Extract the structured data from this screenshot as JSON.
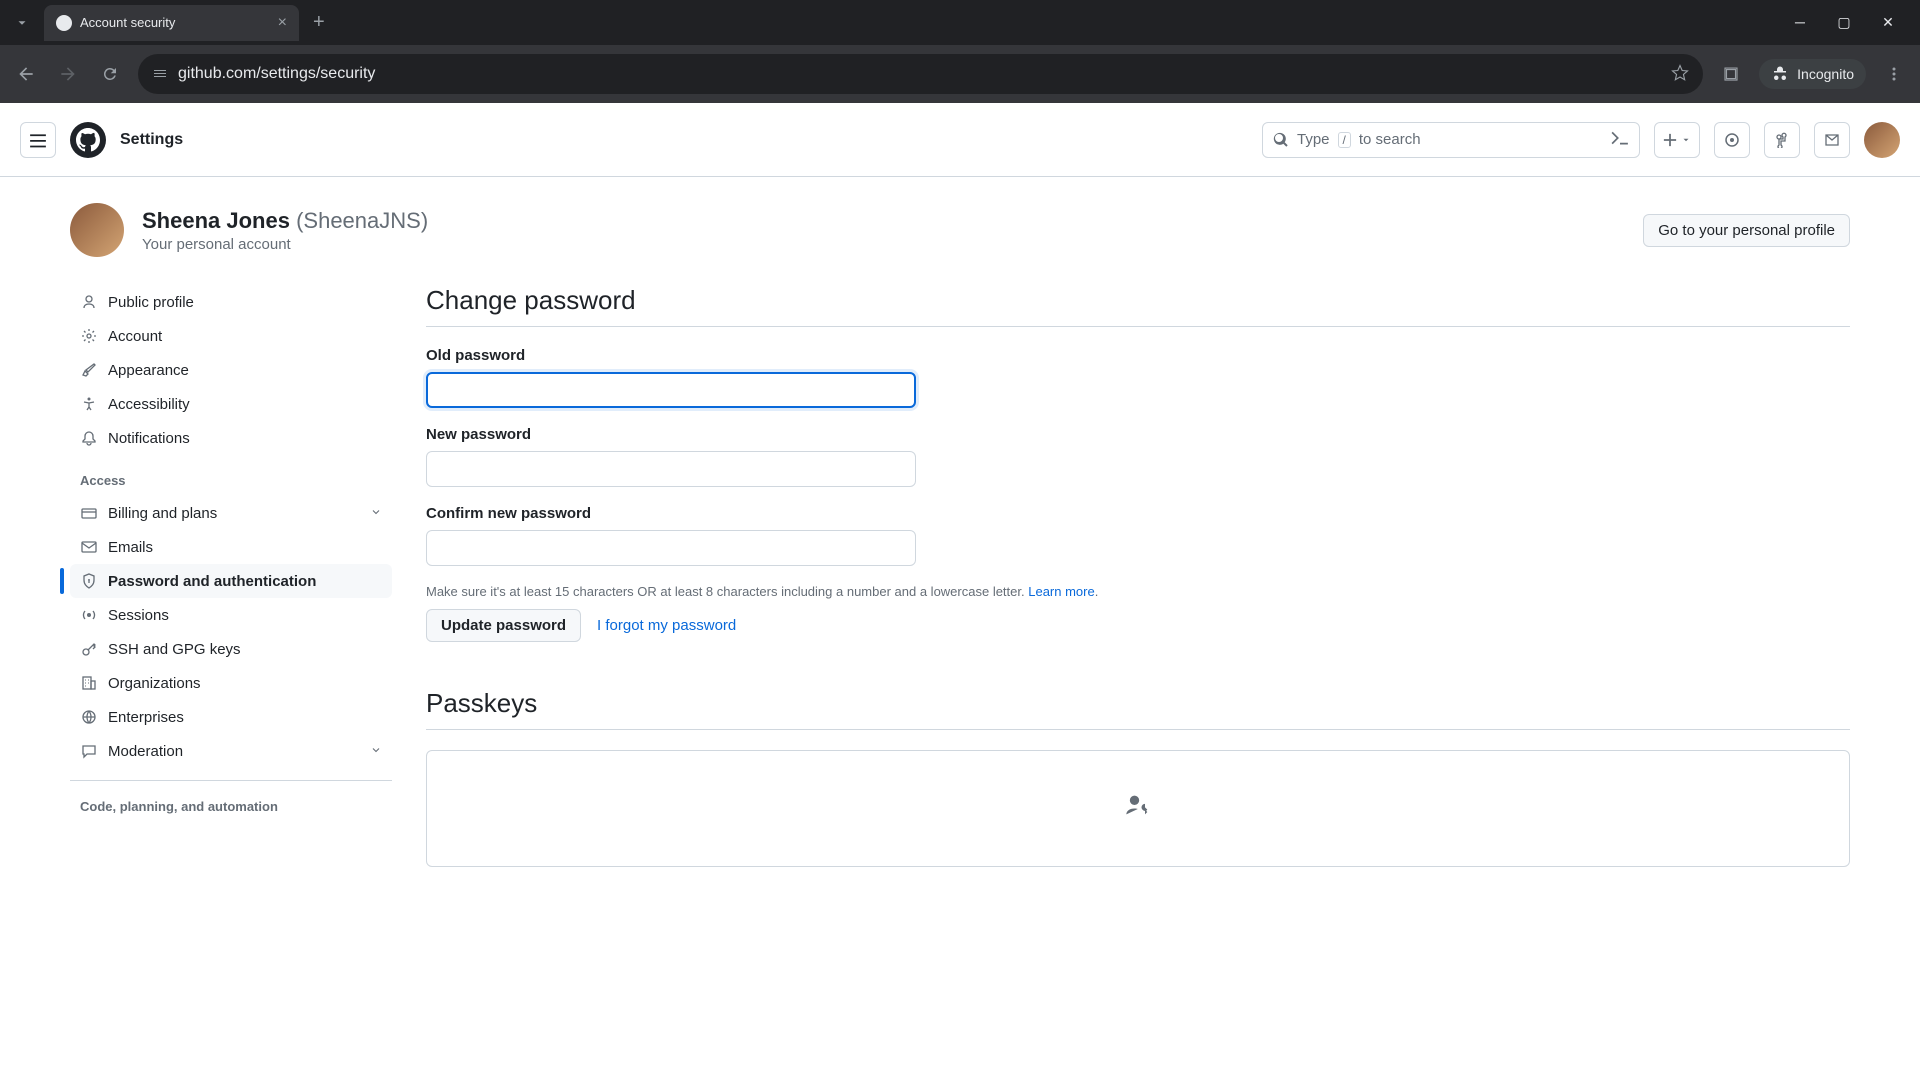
{
  "browser": {
    "tab_title": "Account security",
    "url": "github.com/settings/security",
    "incognito_label": "Incognito"
  },
  "header": {
    "page_title": "Settings",
    "search_prefix": "Type",
    "search_key": "/",
    "search_suffix": "to search"
  },
  "profile": {
    "full_name": "Sheena Jones",
    "username": "(SheenaJNS)",
    "subtitle": "Your personal account",
    "button_label": "Go to your personal profile"
  },
  "sidebar": {
    "items": [
      {
        "label": "Public profile",
        "icon": "person"
      },
      {
        "label": "Account",
        "icon": "gear"
      },
      {
        "label": "Appearance",
        "icon": "brush"
      },
      {
        "label": "Accessibility",
        "icon": "accessibility"
      },
      {
        "label": "Notifications",
        "icon": "bell"
      }
    ],
    "group_access": "Access",
    "access_items": [
      {
        "label": "Billing and plans",
        "icon": "card",
        "expandable": true
      },
      {
        "label": "Emails",
        "icon": "mail"
      },
      {
        "label": "Password and authentication",
        "icon": "shield",
        "active": true
      },
      {
        "label": "Sessions",
        "icon": "broadcast"
      },
      {
        "label": "SSH and GPG keys",
        "icon": "key"
      },
      {
        "label": "Organizations",
        "icon": "org"
      },
      {
        "label": "Enterprises",
        "icon": "globe"
      },
      {
        "label": "Moderation",
        "icon": "comment",
        "expandable": true
      }
    ],
    "group_code": "Code, planning, and automation"
  },
  "main": {
    "change_password_title": "Change password",
    "old_password_label": "Old password",
    "new_password_label": "New password",
    "confirm_password_label": "Confirm new password",
    "hint_text": "Make sure it's at least 15 characters OR at least 8 characters including a number and a lowercase letter.",
    "hint_link": "Learn more",
    "update_button": "Update password",
    "forgot_link": "I forgot my password",
    "passkeys_title": "Passkeys"
  }
}
